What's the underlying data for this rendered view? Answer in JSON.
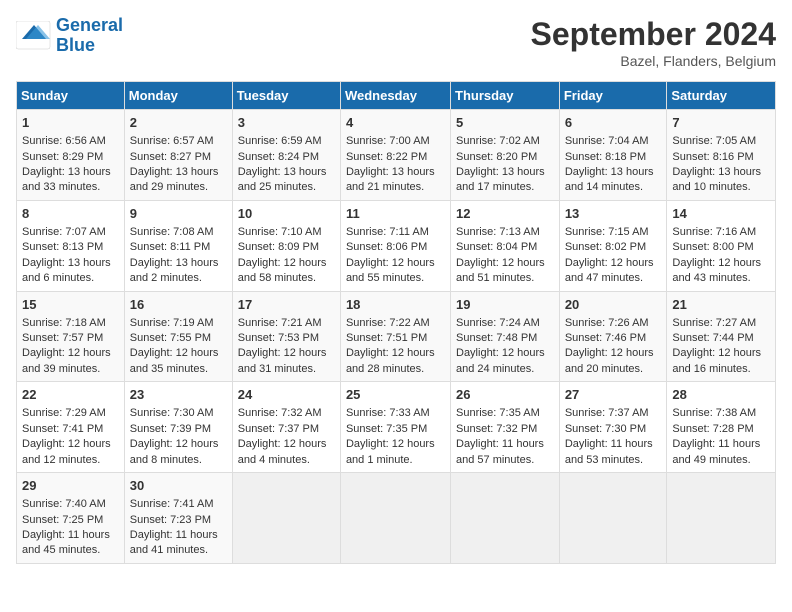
{
  "header": {
    "logo_line1": "General",
    "logo_line2": "Blue",
    "month": "September 2024",
    "location": "Bazel, Flanders, Belgium"
  },
  "days_of_week": [
    "Sunday",
    "Monday",
    "Tuesday",
    "Wednesday",
    "Thursday",
    "Friday",
    "Saturday"
  ],
  "weeks": [
    [
      {
        "day": "1",
        "info": "Sunrise: 6:56 AM\nSunset: 8:29 PM\nDaylight: 13 hours\nand 33 minutes."
      },
      {
        "day": "2",
        "info": "Sunrise: 6:57 AM\nSunset: 8:27 PM\nDaylight: 13 hours\nand 29 minutes."
      },
      {
        "day": "3",
        "info": "Sunrise: 6:59 AM\nSunset: 8:24 PM\nDaylight: 13 hours\nand 25 minutes."
      },
      {
        "day": "4",
        "info": "Sunrise: 7:00 AM\nSunset: 8:22 PM\nDaylight: 13 hours\nand 21 minutes."
      },
      {
        "day": "5",
        "info": "Sunrise: 7:02 AM\nSunset: 8:20 PM\nDaylight: 13 hours\nand 17 minutes."
      },
      {
        "day": "6",
        "info": "Sunrise: 7:04 AM\nSunset: 8:18 PM\nDaylight: 13 hours\nand 14 minutes."
      },
      {
        "day": "7",
        "info": "Sunrise: 7:05 AM\nSunset: 8:16 PM\nDaylight: 13 hours\nand 10 minutes."
      }
    ],
    [
      {
        "day": "8",
        "info": "Sunrise: 7:07 AM\nSunset: 8:13 PM\nDaylight: 13 hours\nand 6 minutes."
      },
      {
        "day": "9",
        "info": "Sunrise: 7:08 AM\nSunset: 8:11 PM\nDaylight: 13 hours\nand 2 minutes."
      },
      {
        "day": "10",
        "info": "Sunrise: 7:10 AM\nSunset: 8:09 PM\nDaylight: 12 hours\nand 58 minutes."
      },
      {
        "day": "11",
        "info": "Sunrise: 7:11 AM\nSunset: 8:06 PM\nDaylight: 12 hours\nand 55 minutes."
      },
      {
        "day": "12",
        "info": "Sunrise: 7:13 AM\nSunset: 8:04 PM\nDaylight: 12 hours\nand 51 minutes."
      },
      {
        "day": "13",
        "info": "Sunrise: 7:15 AM\nSunset: 8:02 PM\nDaylight: 12 hours\nand 47 minutes."
      },
      {
        "day": "14",
        "info": "Sunrise: 7:16 AM\nSunset: 8:00 PM\nDaylight: 12 hours\nand 43 minutes."
      }
    ],
    [
      {
        "day": "15",
        "info": "Sunrise: 7:18 AM\nSunset: 7:57 PM\nDaylight: 12 hours\nand 39 minutes."
      },
      {
        "day": "16",
        "info": "Sunrise: 7:19 AM\nSunset: 7:55 PM\nDaylight: 12 hours\nand 35 minutes."
      },
      {
        "day": "17",
        "info": "Sunrise: 7:21 AM\nSunset: 7:53 PM\nDaylight: 12 hours\nand 31 minutes."
      },
      {
        "day": "18",
        "info": "Sunrise: 7:22 AM\nSunset: 7:51 PM\nDaylight: 12 hours\nand 28 minutes."
      },
      {
        "day": "19",
        "info": "Sunrise: 7:24 AM\nSunset: 7:48 PM\nDaylight: 12 hours\nand 24 minutes."
      },
      {
        "day": "20",
        "info": "Sunrise: 7:26 AM\nSunset: 7:46 PM\nDaylight: 12 hours\nand 20 minutes."
      },
      {
        "day": "21",
        "info": "Sunrise: 7:27 AM\nSunset: 7:44 PM\nDaylight: 12 hours\nand 16 minutes."
      }
    ],
    [
      {
        "day": "22",
        "info": "Sunrise: 7:29 AM\nSunset: 7:41 PM\nDaylight: 12 hours\nand 12 minutes."
      },
      {
        "day": "23",
        "info": "Sunrise: 7:30 AM\nSunset: 7:39 PM\nDaylight: 12 hours\nand 8 minutes."
      },
      {
        "day": "24",
        "info": "Sunrise: 7:32 AM\nSunset: 7:37 PM\nDaylight: 12 hours\nand 4 minutes."
      },
      {
        "day": "25",
        "info": "Sunrise: 7:33 AM\nSunset: 7:35 PM\nDaylight: 12 hours\nand 1 minute."
      },
      {
        "day": "26",
        "info": "Sunrise: 7:35 AM\nSunset: 7:32 PM\nDaylight: 11 hours\nand 57 minutes."
      },
      {
        "day": "27",
        "info": "Sunrise: 7:37 AM\nSunset: 7:30 PM\nDaylight: 11 hours\nand 53 minutes."
      },
      {
        "day": "28",
        "info": "Sunrise: 7:38 AM\nSunset: 7:28 PM\nDaylight: 11 hours\nand 49 minutes."
      }
    ],
    [
      {
        "day": "29",
        "info": "Sunrise: 7:40 AM\nSunset: 7:25 PM\nDaylight: 11 hours\nand 45 minutes."
      },
      {
        "day": "30",
        "info": "Sunrise: 7:41 AM\nSunset: 7:23 PM\nDaylight: 11 hours\nand 41 minutes."
      },
      {
        "day": "",
        "info": ""
      },
      {
        "day": "",
        "info": ""
      },
      {
        "day": "",
        "info": ""
      },
      {
        "day": "",
        "info": ""
      },
      {
        "day": "",
        "info": ""
      }
    ]
  ]
}
